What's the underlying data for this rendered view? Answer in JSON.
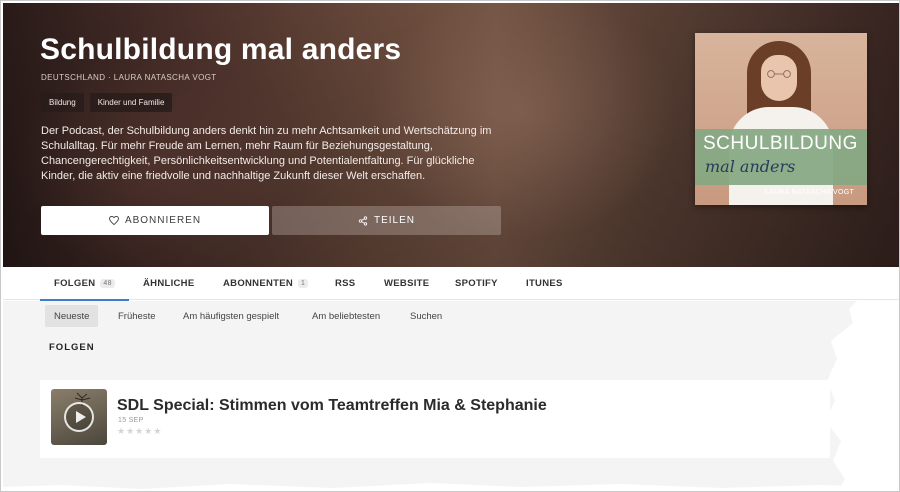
{
  "podcast": {
    "title": "Schulbildung mal anders",
    "subtitle": "DEUTSCHLAND · LAURA NATASCHA VOGT",
    "tags": [
      "Bildung",
      "Kinder und Familie"
    ],
    "description": "Der Podcast, der Schulbildung anders denkt hin zu mehr Achtsamkeit und Wertschätzung im Schulalltag. Für mehr Freude am Lernen, mehr Raum für Beziehungsgestaltung, Chancengerechtigkeit, Persönlichkeitsentwicklung und Potentialentfaltung. Für glückliche Kinder, die aktiv eine friedvolle und nachhaltige Zukunft dieser Welt erschaffen.",
    "subscribe_label": "ABONNIEREN",
    "share_label": "TEILEN"
  },
  "cover": {
    "line1": "SCHULBILDUNG",
    "line2": "mal anders",
    "author": "LAURA NATASCHA VOGT"
  },
  "tabs": [
    {
      "label": "FOLGEN",
      "count": "48"
    },
    {
      "label": "ÄHNLICHE"
    },
    {
      "label": "ABONNENTEN",
      "count": "1"
    },
    {
      "label": "RSS"
    },
    {
      "label": "WEBSITE"
    },
    {
      "label": "SPOTIFY"
    },
    {
      "label": "ITUNES"
    }
  ],
  "active_tab": "FOLGEN",
  "sort_options": [
    "Neueste",
    "Früheste",
    "Am häufigsten gespielt",
    "Am beliebtesten",
    "Suchen"
  ],
  "active_sort": "Neueste",
  "section_title": "FOLGEN",
  "episodes": [
    {
      "title": "SDL Special: Stimmen vom Teamtreffen Mia & Stephanie",
      "date": "15 SEP",
      "rating": 0
    }
  ],
  "colors": {
    "accent": "#3d7fc2",
    "cover_band": "#84a882"
  },
  "icons": {
    "subscribe": "heart-icon",
    "share": "share-icon",
    "episode": "play-icon",
    "rating": "star-icon"
  }
}
